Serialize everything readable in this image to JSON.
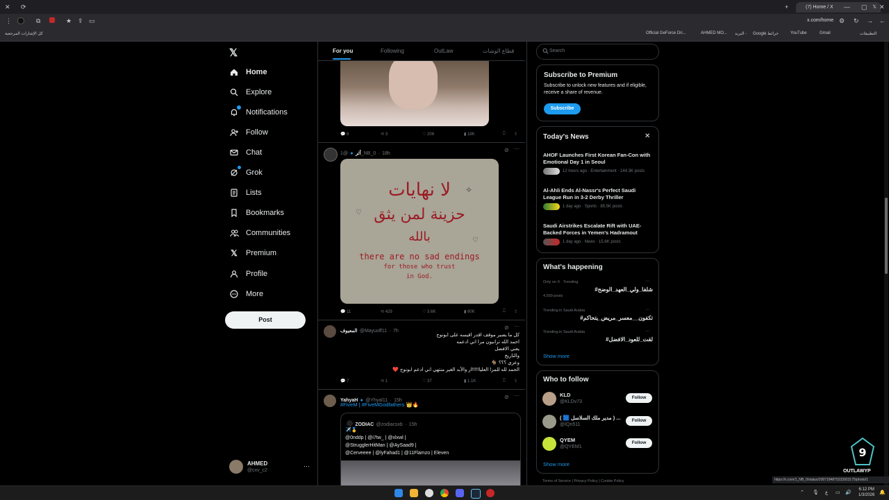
{
  "browser": {
    "tab_title": "(7) Home / X",
    "url": "x.com/home",
    "bookmarks_left": "كل الإشارات المرجعية",
    "bookmarks": [
      "Official GeForce Dri...",
      "AHMED MO...",
      "البريد -",
      "Google خرائط",
      "YouTube",
      "Gmail",
      "التطبيقات"
    ]
  },
  "nav": {
    "items": [
      {
        "label": "Home",
        "icon": "home-icon"
      },
      {
        "label": "Explore",
        "icon": "search-icon"
      },
      {
        "label": "Notifications",
        "icon": "bell-icon"
      },
      {
        "label": "Follow",
        "icon": "person-add-icon"
      },
      {
        "label": "Chat",
        "icon": "mail-icon"
      },
      {
        "label": "Grok",
        "icon": "grok-icon"
      },
      {
        "label": "Lists",
        "icon": "list-icon"
      },
      {
        "label": "Bookmarks",
        "icon": "bookmark-icon"
      },
      {
        "label": "Communities",
        "icon": "people-icon"
      },
      {
        "label": "Premium",
        "icon": "x-logo-icon"
      },
      {
        "label": "Profile",
        "icon": "person-icon"
      },
      {
        "label": "More",
        "icon": "more-circle-icon"
      }
    ],
    "post_label": "Post",
    "account": {
      "name": "AHMED",
      "handle": "@cxv_c2"
    }
  },
  "feed": {
    "tabs": [
      "For you",
      "Following",
      "OutLaw",
      "قطاع الوشات"
    ],
    "post1": {
      "replies": "6",
      "reposts": "3",
      "likes": "206",
      "views": "18K"
    },
    "post2": {
      "name": "أثر",
      "handle": "@1_NB_0",
      "time": "18h",
      "image_text_ar1": "لا نهايات",
      "image_text_ar2": "حزينة لمن يثق",
      "image_text_ar3": "بالله",
      "image_text_en1": "there are no sad endings",
      "image_text_en2": "for those who trust",
      "image_text_en3": "in God.",
      "replies": "11",
      "reposts": "429",
      "likes": "3.6K",
      "views": "60K"
    },
    "post3": {
      "name": "المعيوف",
      "handle": "@Mayuoff11",
      "time": "7h",
      "lines": [
        "كل ما يصير موقف اقدر اقيسه على ابونوج",
        "احمد الله ترانيون مرا اني ادعمه",
        "يعني الافضل",
        "والتاريخ",
        "وعزي ؟؟؟ 🐐",
        "الحمد لله للمرا العليا!!!!!ار والأبد الغير منتهي اني ادعم ابونوج ❤️"
      ],
      "replies": "7",
      "reposts": "1",
      "likes": "37",
      "views": "1.1K"
    },
    "post4": {
      "name": "YahyaH",
      "handle": "@Yhyal11",
      "time": "15h",
      "text": "#FiveM | #FiveMGodfathers 👑🔥",
      "quote": {
        "name": "ZODIAC",
        "handle": "@zodiacsxb",
        "time": "15h",
        "line1": "✈️🥇",
        "line2": "@0nddp | @i7tw_ | @xlxwl |",
        "line3": "@StrugglerHitMan | @AySaad9 |",
        "line4": "@Cerveeee | @lyFahad1 | @11Flamzo | Eleven"
      }
    }
  },
  "right": {
    "search_placeholder": "Search",
    "premium": {
      "title": "Subscribe to Premium",
      "body": "Subscribe to unlock new features and if eligible, receive a share of revenue.",
      "button": "Subscribe"
    },
    "news": {
      "title": "Today's News",
      "items": [
        {
          "title": "AHOF Launches First Korean Fan-Con with Emotional Day 1 in Seoul",
          "meta": "12 hours ago · Entertainment · 144.3K posts"
        },
        {
          "title": "Al-Ahli Ends Al-Nassr's Perfect Saudi League Run in 3-2 Derby Thriller",
          "meta": "1 day ago · Sports · 85.5K posts"
        },
        {
          "title": "Saudi Airstrikes Escalate Rift with UAE-Backed Forces in Yemen's Hadramout",
          "meta": "1 day ago · News · 15.6K posts"
        }
      ]
    },
    "happening": {
      "title": "What's happening",
      "items": [
        {
          "context": "Only on X · Trending",
          "tag": "#شلفا_ولي_العهد_الوضح",
          "posts": "4,559 posts"
        },
        {
          "context": "Trending in Saudi Arabia",
          "tag": "#تكفون__معسر_مريض_يتحاكم",
          "posts": ""
        },
        {
          "context": "Trending in Saudi Arabia",
          "tag": "#لقت_للعود_الافضل",
          "posts": ""
        }
      ],
      "show_more": "Show more"
    },
    "who_to_follow": {
      "title": "Who to follow",
      "items": [
        {
          "name": "KLD",
          "handle": "@KLDv73"
        },
        {
          "name": "( 🟦 مدير ملك السلاسل ) ...",
          "handle": "@IQn511"
        },
        {
          "name": "QYEM",
          "handle": "@QYEM1"
        }
      ],
      "follow_label": "Follow",
      "show_more": "Show more"
    },
    "footer": "Terms of Service | Privacy Policy | Cookie Policy"
  },
  "status_url": "https://x.com/1_NB_0/status/2007184875233923175/photo/1",
  "watermark": "OUTLAWYP",
  "clock": {
    "time": "6:12 PM",
    "date": "1/3/2026"
  },
  "colors": {
    "accent": "#1d9bf0",
    "bg": "#000000",
    "border": "#2f3336",
    "muted": "#71767b"
  }
}
